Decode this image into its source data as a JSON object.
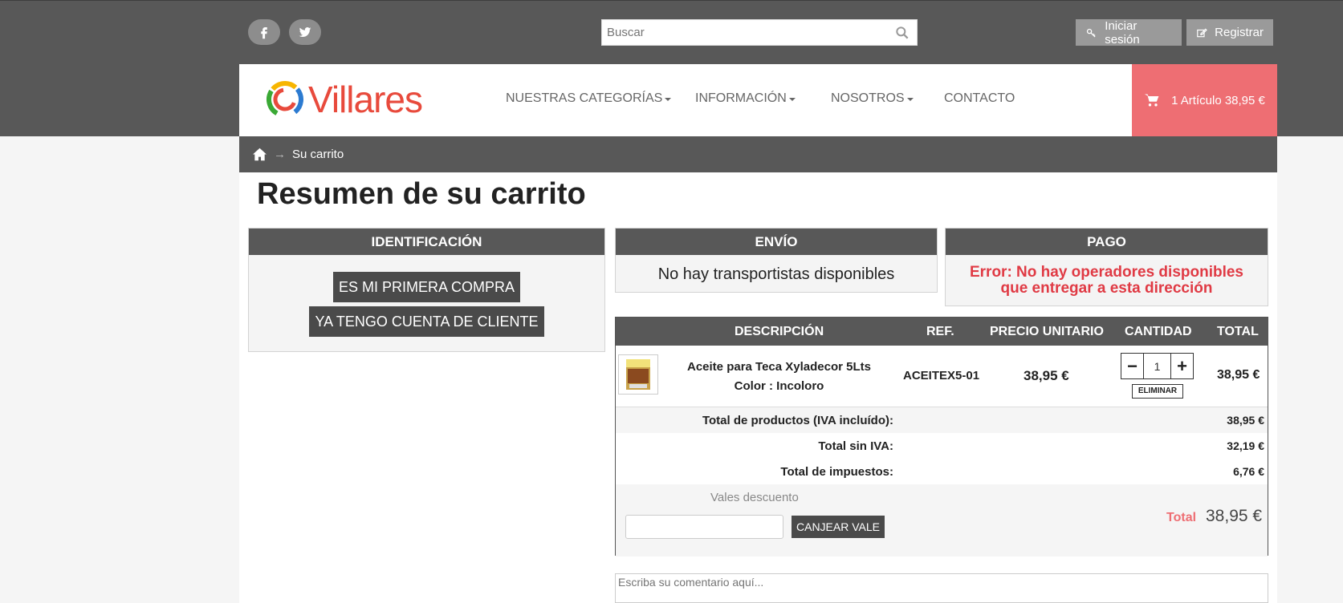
{
  "topbar": {
    "social": [
      {
        "name": "facebook",
        "glyph": "f"
      },
      {
        "name": "twitter",
        "glyph": "twitter-bird"
      }
    ],
    "search": {
      "placeholder": "Buscar",
      "value": ""
    },
    "login_label": "Iniciar sesión",
    "register_label": "Registrar"
  },
  "header": {
    "logo_text": "Villares",
    "nav": [
      {
        "label": "NUESTRAS CATEGORÍAS",
        "has_dropdown": true
      },
      {
        "label": "INFORMACIÓN",
        "has_dropdown": true
      },
      {
        "label": "NOSOTROS",
        "has_dropdown": true
      },
      {
        "label": "CONTACTO",
        "has_dropdown": false
      }
    ],
    "cart_summary": "1 Artículo 38,95 €"
  },
  "breadcrumb": {
    "current": "Su carrito",
    "separator": "→"
  },
  "page_title": "Resumen de su carrito",
  "identification": {
    "title": "IDENTIFICACIÓN",
    "first_purchase_label": "ES MI PRIMERA COMPRA",
    "have_account_label": "YA TENGO CUENTA DE CLIENTE"
  },
  "shipping": {
    "title": "ENVÍO",
    "message": "No hay transportistas disponibles"
  },
  "payment": {
    "title": "PAGO",
    "error": "Error: No hay operadores disponibles que entregar a esta dirección"
  },
  "cart_table": {
    "headers": {
      "description": "DESCRIPCIÓN",
      "ref": "REF.",
      "unit_price": "PRECIO UNITARIO",
      "quantity": "CANTIDAD",
      "total": "TOTAL"
    },
    "items": [
      {
        "name": "Aceite para Teca Xyladecor 5Lts",
        "variant": "Color : Incoloro",
        "ref": "ACEITEX5-01",
        "unit_price": "38,95 €",
        "quantity": "1",
        "total": "38,95 €",
        "remove_label": "ELIMINAR"
      }
    ],
    "summary": [
      {
        "label": "Total de productos (IVA incluído):",
        "value": "38,95 €"
      },
      {
        "label": "Total sin IVA:",
        "value": "32,19 €"
      },
      {
        "label": "Total de impuestos:",
        "value": "6,76 €"
      }
    ],
    "discount": {
      "label": "Vales descuento",
      "input_value": "",
      "button_label": "CANJEAR VALE"
    },
    "grand_total": {
      "label": "Total",
      "value": "38,95 €"
    }
  },
  "comment": {
    "placeholder": "Escriba su comentario aquí..."
  },
  "colors": {
    "topband": "#585858",
    "cart_accent": "#ee6e73",
    "error": "#e03a44",
    "logo_red": "#e84a3c"
  }
}
